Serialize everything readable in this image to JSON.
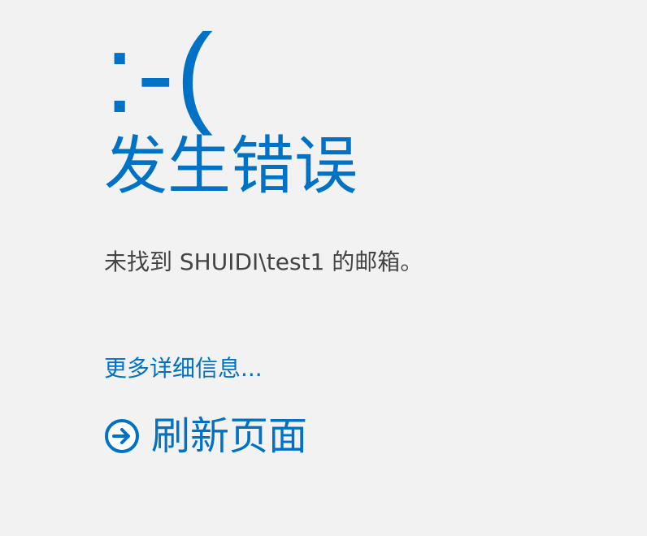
{
  "error": {
    "emoticon": ":-(",
    "title": "发生错误",
    "message": "未找到 SHUIDI\\test1 的邮箱。"
  },
  "links": {
    "more_details": "更多详细信息...",
    "refresh": "刷新页面"
  },
  "icons": {
    "refresh": "arrow-right-circle-icon"
  },
  "colors": {
    "background": "#f2f2f2",
    "accent": "#0072c6",
    "text": "#444444"
  }
}
